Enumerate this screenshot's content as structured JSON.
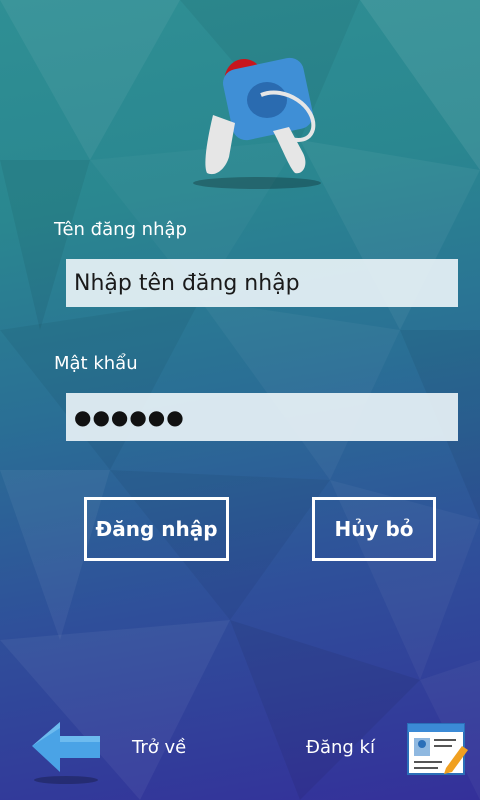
{
  "form": {
    "username_label": "Tên đăng nhập",
    "username_placeholder": "Nhập tên đăng nhập",
    "password_label": "Mật khẩu",
    "password_value": "●●●●●●"
  },
  "buttons": {
    "login": "Đăng nhập",
    "cancel": "Hủy bỏ"
  },
  "footer": {
    "back_label": "Trở về",
    "register_label": "Đăng kí"
  },
  "icons": {
    "logo": "key-logo-icon",
    "back": "back-arrow-icon",
    "register": "registration-form-icon"
  },
  "colors": {
    "background_top": "#2f8f94",
    "background_bottom": "#34309a",
    "field_background": "#e8f2f6",
    "button_border": "#ffffff"
  }
}
